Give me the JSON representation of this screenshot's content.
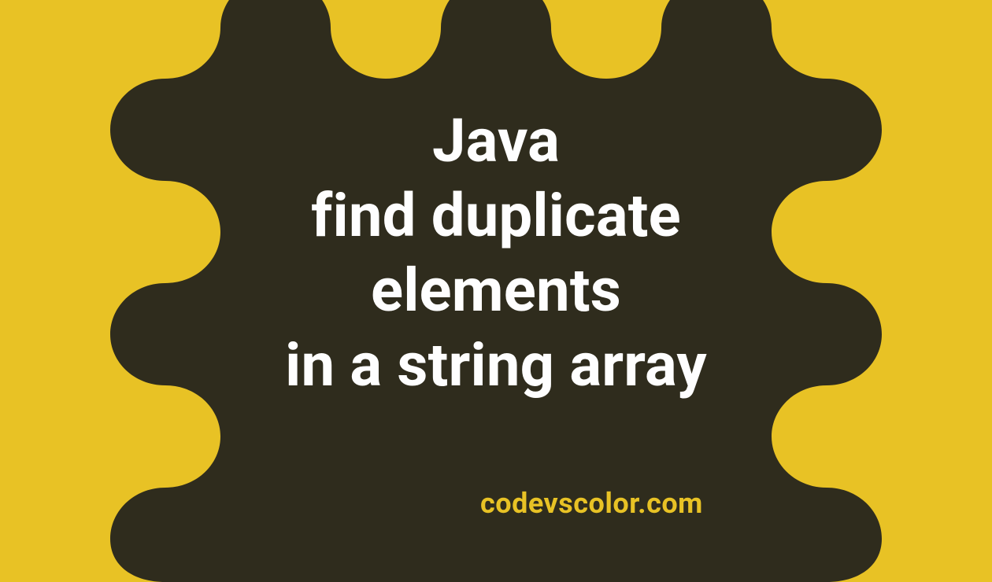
{
  "title_lines": [
    "Java",
    "find duplicate",
    "elements",
    "in a string array"
  ],
  "credit": "codevscolor.com",
  "colors": {
    "bg": "#e8c225",
    "blob": "#2f2c1d",
    "title": "#ffffff"
  }
}
